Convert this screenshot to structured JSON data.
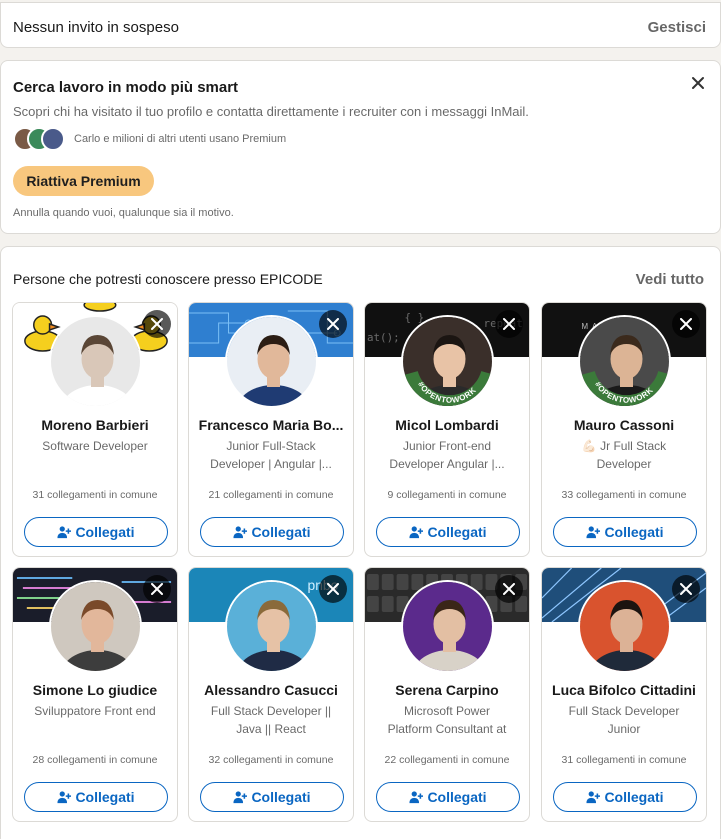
{
  "invitations": {
    "status_text": "Nessun invito in sospeso",
    "manage_label": "Gestisci"
  },
  "premium": {
    "title": "Cerca lavoro in modo più smart",
    "description": "Scopri chi ha visitato il tuo profilo e contatta direttamente i recruiter con i messaggi InMail.",
    "social_proof": "Carlo e milioni di altri utenti usano Premium",
    "cta_label": "Riattiva Premium",
    "footer": "Annulla quando vuoi, qualunque sia il motivo.",
    "cta_color": "#f8c77e"
  },
  "pymk": {
    "title": "Persone che potresti conoscere presso EPICODE",
    "see_all_label": "Vedi tutto",
    "connect_label": "Collegati",
    "people": [
      {
        "name": "Moreno Barbieri",
        "headline": "Software Developer",
        "mutual": "31 collegamenti in comune",
        "cover": "ducks",
        "skin": "#d9c7b8",
        "bg": "#e8e8e8",
        "shirt": "#ffffff",
        "hair": "#5a4636",
        "open_to_work": false
      },
      {
        "name": "Francesco Maria Bo...",
        "headline": "Junior Full-Stack Developer | Angular |...",
        "mutual": "21 collegamenti in comune",
        "cover": "circuit",
        "skin": "#e1b89a",
        "bg": "#e9eef4",
        "shirt": "#1f3b73",
        "hair": "#2b1d14",
        "open_to_work": false
      },
      {
        "name": "Micol Lombardi",
        "headline": "Junior Front-end Developer Angular |...",
        "mutual": "9 collegamenti in comune",
        "cover": "code",
        "skin": "#e8c3a6",
        "bg": "#3a2f2a",
        "shirt": "#2a2a2a",
        "hair": "#1b1512",
        "open_to_work": true
      },
      {
        "name": "Mauro Cassoni",
        "headline": "💪🏻 Jr Full Stack Developer",
        "mutual": "33 collegamenti in comune",
        "cover": "dark",
        "skin": "#dcb495",
        "bg": "#4a4a4a",
        "shirt": "#1a1a1a",
        "hair": "#3b2a1c",
        "open_to_work": true
      },
      {
        "name": "Simone Lo giudice",
        "headline": "Sviluppatore Front end",
        "mutual": "28 collegamenti in comune",
        "cover": "code2",
        "skin": "#e2b79b",
        "bg": "#cfc8bf",
        "shirt": "#3d3d3d",
        "hair": "#7a4a2a",
        "open_to_work": false
      },
      {
        "name": "Alessandro Casucci",
        "headline": "Full Stack Developer || Java || React",
        "mutual": "32 collegamenti in comune",
        "cover": "blue",
        "skin": "#e6c2a6",
        "bg": "#5ab0d8",
        "shirt": "#1f2b45",
        "hair": "#8a6a3a",
        "open_to_work": false
      },
      {
        "name": "Serena Carpino",
        "headline": "Microsoft Power Platform Consultant at Altitudo",
        "mutual": "22 collegamenti in comune",
        "cover": "keyboard",
        "skin": "#e3bfa3",
        "bg": "#5b2a8c",
        "shirt": "#d8d2c8",
        "hair": "#3a2618",
        "open_to_work": false
      },
      {
        "name": "Luca Bifolco Cittadini",
        "headline": "Full Stack Developer Junior",
        "mutual": "31 collegamenti in comune",
        "cover": "lines",
        "skin": "#dcb296",
        "bg": "#d9532e",
        "shirt": "#1f2a3a",
        "hair": "#1c1410",
        "open_to_work": false
      }
    ]
  },
  "icons": {
    "dismiss": "close-icon",
    "connect": "add-person-icon"
  },
  "colors": {
    "accent": "#0a66c2",
    "page_bg": "#f4f2ee"
  }
}
